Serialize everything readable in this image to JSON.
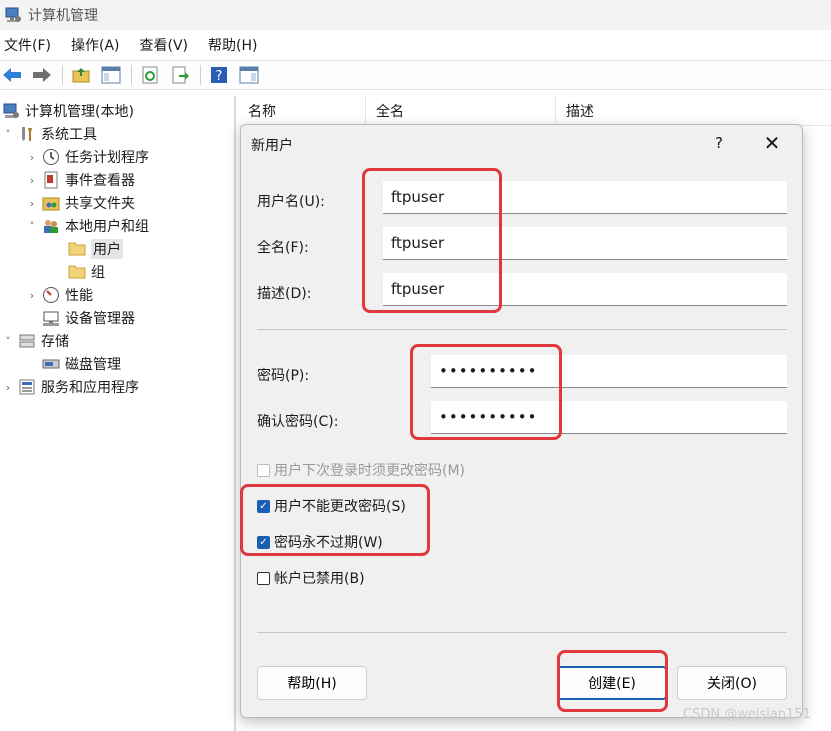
{
  "window": {
    "title": "计算机管理"
  },
  "menu": [
    "文件(F)",
    "操作(A)",
    "查看(V)",
    "帮助(H)"
  ],
  "toolbar": [
    "back-icon",
    "forward-icon",
    "up-folder-icon",
    "console-tree-icon",
    "refresh-icon",
    "export-icon",
    "help-icon",
    "show-action-pane-icon"
  ],
  "tree": {
    "root": "计算机管理(本地)",
    "system_tools": "系统工具",
    "task_scheduler": "任务计划程序",
    "event_viewer": "事件查看器",
    "shared_folders": "共享文件夹",
    "local_users_groups": "本地用户和组",
    "users": "用户",
    "groups": "组",
    "performance": "性能",
    "device_manager": "设备管理器",
    "storage": "存储",
    "disk_management": "磁盘管理",
    "services_apps": "服务和应用程序"
  },
  "list": {
    "columns": [
      "名称",
      "全名",
      "描述"
    ]
  },
  "dialog": {
    "title": "新用户",
    "help_glyph": "?",
    "close_glyph": "✕",
    "username_label": "用户名(U):",
    "username_value": "ftpuser",
    "fullname_label": "全名(F):",
    "fullname_value": "ftpuser",
    "description_label": "描述(D):",
    "description_value": "ftpuser",
    "password_label": "密码(P):",
    "password_value": "••••••••••",
    "confirm_label": "确认密码(C):",
    "confirm_value": "••••••••••",
    "chk_must_change": "用户下次登录时须更改密码(M)",
    "chk_cannot_change": "用户不能更改密码(S)",
    "chk_never_expires": "密码永不过期(W)",
    "chk_disabled": "帐户已禁用(B)",
    "btn_help": "帮助(H)",
    "btn_create": "创建(E)",
    "btn_close": "关闭(O)",
    "checked": {
      "must_change": false,
      "cannot_change": true,
      "never_expires": true,
      "disabled": false
    }
  },
  "colors": {
    "accent": "#1a5fb4",
    "highlight": "#e0383e"
  },
  "watermark": "CSDN @weisian151"
}
